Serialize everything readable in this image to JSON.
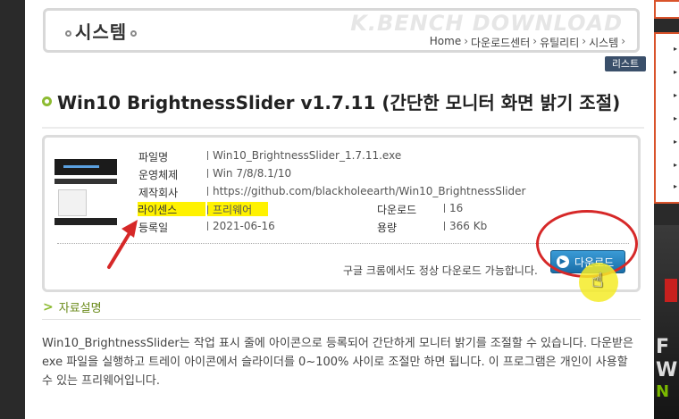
{
  "header": {
    "category_title": "시스템",
    "watermark": "K.BENCH DOWNLOAD",
    "breadcrumb": [
      "Home",
      "다운로드센터",
      "유틸리티",
      "시스템"
    ],
    "list_button": "리스트"
  },
  "program": {
    "title": "Win10 BrightnessSlider v1.7.11 (간단한 모니터 화면 밝기 조절)"
  },
  "info": {
    "fields": [
      {
        "label": "파일명",
        "value": "Win10_BrightnessSlider_1.7.11.exe"
      },
      {
        "label": "운영체제",
        "value": "Win 7/8/8.1/10"
      },
      {
        "label": "제작회사",
        "value": "https://github.com/blackholeearth/Win10_BrightnessSlider"
      },
      {
        "label": "라이센스",
        "value": "프리웨어"
      },
      {
        "label": "등록일",
        "value": "2021-06-16"
      }
    ],
    "right_fields": [
      {
        "label": "다운로드",
        "value": "16"
      },
      {
        "label": "용량",
        "value": "366 Kb"
      }
    ],
    "note": "구글 크롬에서도 정상 다운로드 가능합니다.",
    "download_button": "다운로드"
  },
  "section": {
    "label": "자료설명",
    "description": "Win10_BrightnessSlider는 작업 표시 줄에 아이콘으로 등록되어 간단하게 모니터 밝기를 조절할 수 있습니다. 다운받은 exe 파일을 실행하고 트레이 아이콘에서 슬라이더를 0~100% 사이로 조절만 하면 됩니다. 이 프로그램은 개인이 사용할 수 있는 프리웨어입니다."
  },
  "sidebar_ad": {
    "letters": [
      "F",
      "W"
    ],
    "green_text": "N"
  },
  "colors": {
    "accent_green": "#8dbb32",
    "highlight_yellow": "#fff200",
    "annotation_red": "#d62828",
    "button_blue": "#1a6ea8"
  }
}
